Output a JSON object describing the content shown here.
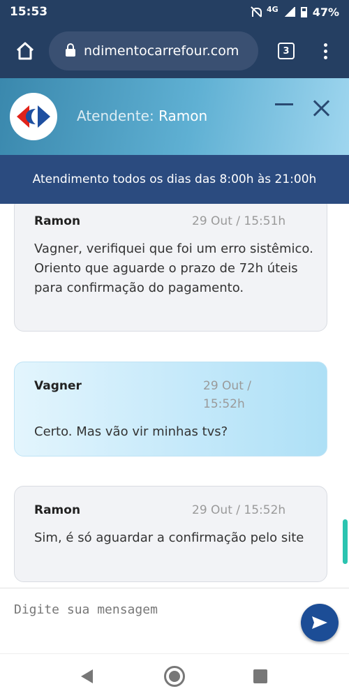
{
  "status_bar": {
    "time": "15:53",
    "network": "4G",
    "battery": "47%"
  },
  "browser": {
    "url": "ndimentocarrefour.com",
    "tab_count": "3"
  },
  "chat_header": {
    "agent_prefix": "Atendente: ",
    "agent_name": "Ramon"
  },
  "banner": {
    "hours_text": "Atendimento todos os dias das 8:00h às 21:00h"
  },
  "messages": [
    {
      "sender": "Ramon",
      "time": "29 Out / 15:51h",
      "text": "Vagner, verifiquei que foi um erro sistêmico. Oriento que aguarde o prazo de 72h úteis para confirmação do pagamento."
    },
    {
      "sender": "Vagner",
      "time_line1": "29 Out /",
      "time_line2": "15:52h",
      "text": "Certo. Mas vão vir minhas tvs?"
    },
    {
      "sender": "Ramon",
      "time": "29 Out / 15:52h",
      "text": "Sim, é só aguardar a confirmação pelo site"
    }
  ],
  "input": {
    "placeholder": "Digite sua mensagem"
  }
}
